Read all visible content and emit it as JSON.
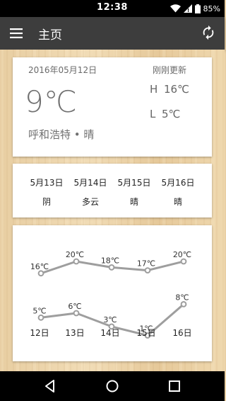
{
  "status_bar": {
    "time": "12:38",
    "battery": "85%",
    "icons": [
      "wifi-icon",
      "signal-icon",
      "battery-icon"
    ]
  },
  "app_bar": {
    "title": "主页",
    "menu_icon": "menu-icon",
    "refresh_icon": "refresh-icon",
    "background": "#3d3d3d"
  },
  "current": {
    "date": "2016年05月12日",
    "updated": "刚刚更新",
    "temperature": "9℃",
    "high_label": "H",
    "high": "16℃",
    "low_label": "L",
    "low": "5℃",
    "location": "呼和浩特 • 晴"
  },
  "forecast": [
    {
      "date": "5月13日",
      "weather": "阴"
    },
    {
      "date": "5月14日",
      "weather": "多云"
    },
    {
      "date": "5月15日",
      "weather": "晴"
    },
    {
      "date": "5月16日",
      "weather": "晴"
    }
  ],
  "chart_data": {
    "type": "line",
    "categories": [
      "12日",
      "13日",
      "14日",
      "15日",
      "16日"
    ],
    "series": [
      {
        "values": [
          16,
          20,
          18,
          17,
          20
        ],
        "labels": [
          "16℃",
          "20℃",
          "18℃",
          "17℃",
          "20℃"
        ]
      },
      {
        "values": [
          5,
          6,
          3,
          1,
          8
        ],
        "labels": [
          "5℃",
          "6℃",
          "3℃",
          "1℃",
          "8℃"
        ]
      }
    ],
    "line_color": "#9e9e9e"
  },
  "nav_bar": {
    "icons": [
      "back-icon",
      "home-icon",
      "recents-icon"
    ]
  }
}
